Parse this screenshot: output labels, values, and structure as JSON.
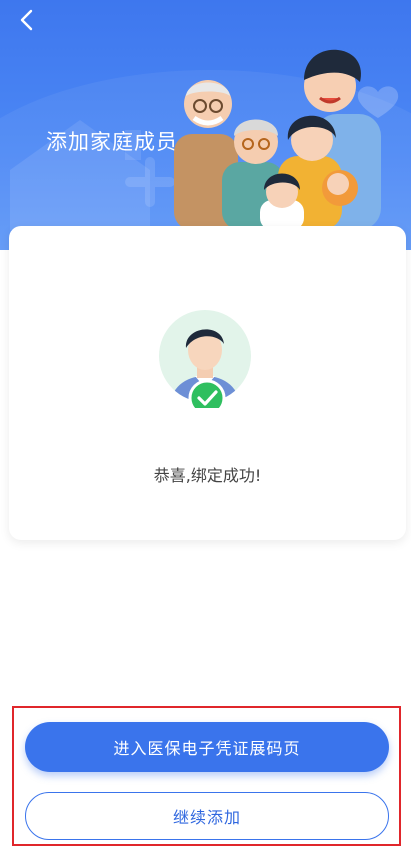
{
  "header": {
    "title": "添加家庭成员",
    "back_icon": "chevron-left-icon",
    "background": "#3e77ee"
  },
  "card": {
    "message": "恭喜,绑定成功!",
    "badge_color": "#2fbf5f"
  },
  "actions": {
    "primary_label": "进入医保电子凭证展码页",
    "secondary_label": "继续添加",
    "accent": "#3a74ec"
  }
}
